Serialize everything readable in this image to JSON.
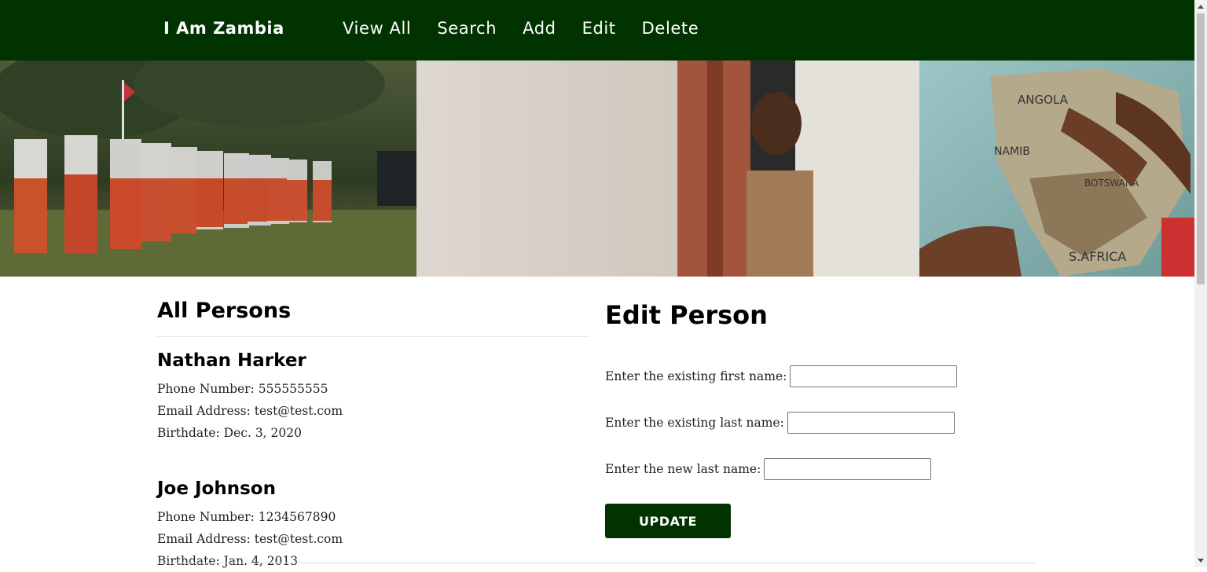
{
  "navbar": {
    "brand": "I Am Zambia",
    "links": [
      "View All",
      "Search",
      "Add",
      "Edit",
      "Delete"
    ]
  },
  "banner": {
    "map_labels": [
      "ANGOLA",
      "NAMIB",
      "BOTSWANA",
      "S.AFRICA"
    ]
  },
  "all_persons": {
    "title": "All Persons",
    "people": [
      {
        "name": "Nathan Harker",
        "phone": "Phone Number: 555555555",
        "email": "Email Address: test@test.com",
        "birthdate": "Birthdate: Dec. 3, 2020"
      },
      {
        "name": "Joe Johnson",
        "phone": "Phone Number: 1234567890",
        "email": "Email Address: test@test.com",
        "birthdate": "Birthdate: Jan. 4, 2013"
      }
    ]
  },
  "edit_person": {
    "title": "Edit Person",
    "first_name_label": "Enter the existing first name:",
    "first_name_value": "",
    "last_name_label": "Enter the existing last name:",
    "last_name_value": "",
    "new_last_name_label": "Enter the new last name:",
    "new_last_name_value": "",
    "submit_label": "UPDATE"
  },
  "colors": {
    "nav_bg": "#003300",
    "button_bg": "#003300"
  }
}
